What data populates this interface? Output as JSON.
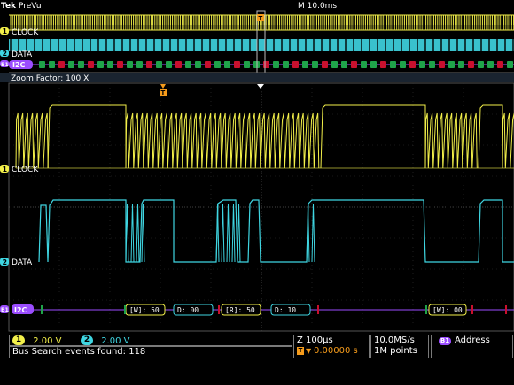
{
  "header": {
    "brand_prefix": "Tek",
    "mode": "PreVu",
    "timebase_label": "M 10.0ms"
  },
  "zoom": {
    "label": "Zoom Factor: 100 X"
  },
  "channels": {
    "ch1": {
      "number": "1",
      "name": "CLOCK",
      "color": "#f3f04a",
      "scale": "2.00 V"
    },
    "ch2": {
      "number": "2",
      "name": "DATA",
      "color": "#3fd6e2",
      "scale": "2.00 V"
    }
  },
  "bus": {
    "number": "B1",
    "protocol": "I2C",
    "color": "#9b4dff",
    "packets": [
      {
        "label": "[W]: 50"
      },
      {
        "label": "D: 00"
      },
      {
        "label": "[R]: 50"
      },
      {
        "label": "D: 10"
      },
      {
        "label": "[W]: 00"
      }
    ]
  },
  "markers": {
    "trigger": "T"
  },
  "status": {
    "search_results": "Bus Search events found: 118",
    "horizontal_scale": "Z 100µs",
    "trigger_position": "0.00000 s",
    "sample_rate": "10.0MS/s",
    "record_length": "1M points",
    "trigger_type": "Address"
  }
}
